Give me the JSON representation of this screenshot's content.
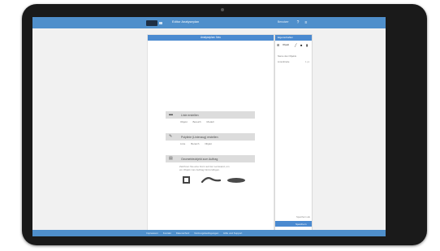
{
  "header": {
    "app_title": "Editor Analyseplan",
    "user": "Benutzer",
    "icons": [
      "help-icon",
      "menu-icon"
    ]
  },
  "document": {
    "title": "Analyseplan: Neu",
    "sections": [
      {
        "icon": "ruler-icon",
        "title": "Linie erstellen",
        "items": [
          "Objekt",
          "Bereich",
          "Modell"
        ]
      },
      {
        "icon": "pen-icon",
        "title": "Polylinie (Linienzug) erstellen",
        "items": [
          "Linie",
          "Bereich",
          "Objekt"
        ]
      },
      {
        "icon": "layers-icon",
        "title": "Geometrieobjekt zum Auftrag",
        "description_1": "Zeichnen Sie eine Form auf der Leinwand, um",
        "description_2": "ein Objekt zum Auftrag hinzuzufügen."
      }
    ],
    "shape_names": [
      "square-shape-icon",
      "wave-shape-icon",
      "ellipse-shape-icon"
    ]
  },
  "sidebar": {
    "title": "Eigenschaften",
    "tools": [
      "Objekt",
      "Linie",
      "Text",
      "Löschen",
      "Einstellungen"
    ],
    "rows": [
      {
        "label": "Name des Objekts",
        "value": ""
      },
      {
        "label": "Linienbreite",
        "value": "1 px"
      }
    ],
    "footer_text": "Speichern als",
    "button_label": "Speichern"
  },
  "footer": {
    "links": [
      "Impressum",
      "Kontakt",
      "Datenschutz",
      "Nutzungsbedingungen",
      "Hilfe und Support"
    ]
  },
  "colors": {
    "accent": "#4a8ad0",
    "bar": "#4f8fcb",
    "frame": "#1a1a1a"
  }
}
